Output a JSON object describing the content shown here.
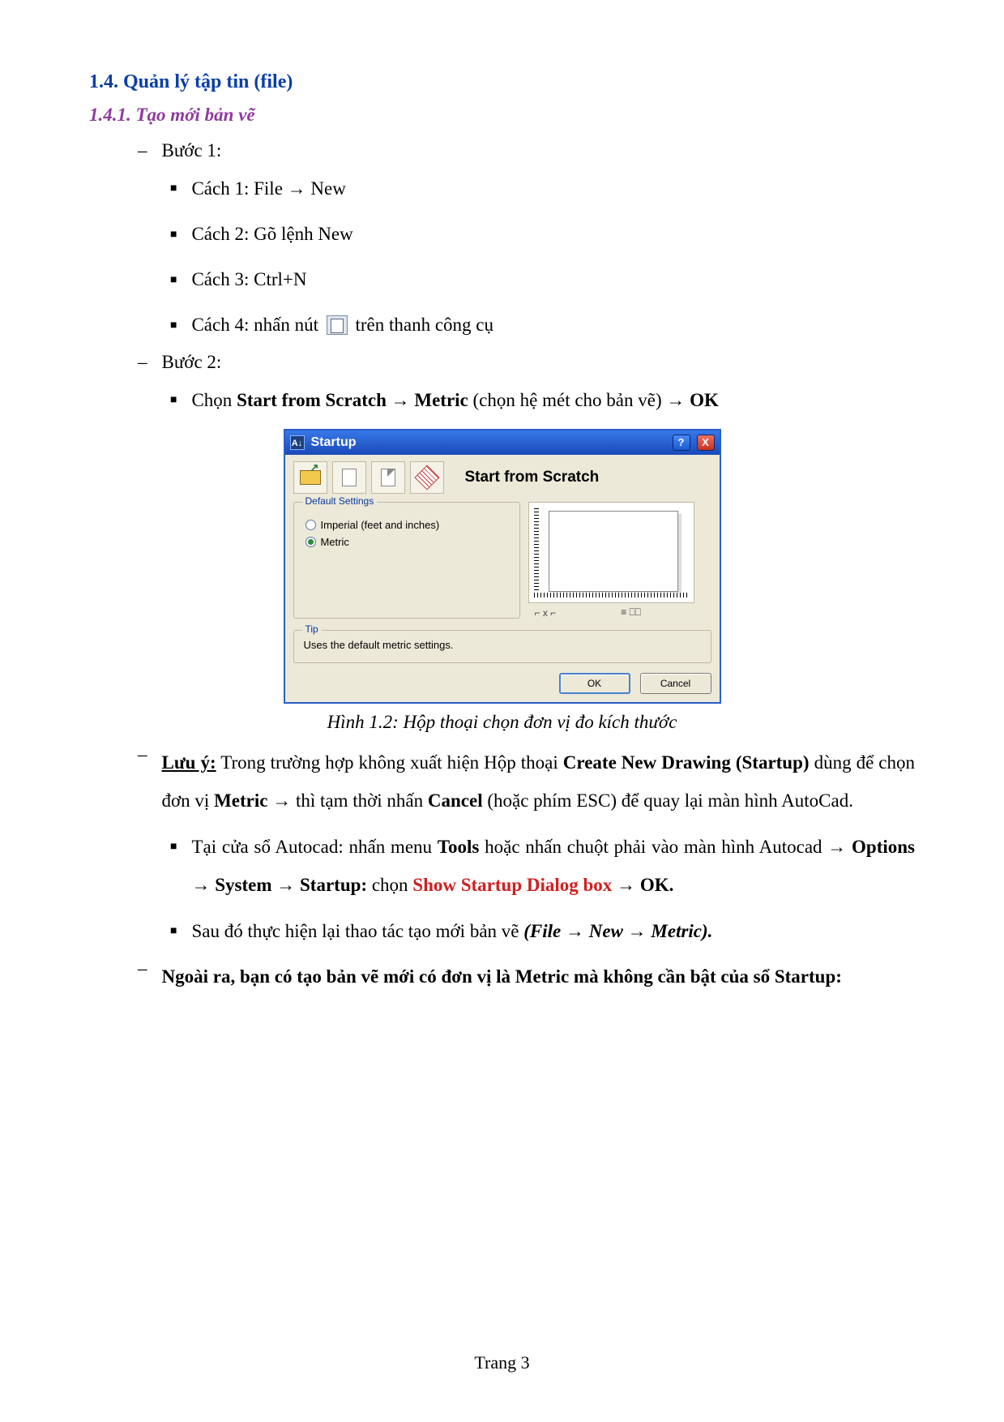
{
  "heading1": "1.4.  Quản lý tập tin (file)",
  "heading2": "1.4.1.  Tạo mới bản vẽ",
  "step1_label": "Bước 1:",
  "step1_ways": {
    "way1_a": "Cách 1: File ",
    "way1_b": " New",
    "way2": "Cách 2: Gõ lệnh New",
    "way3": "Cách 3: Ctrl+N",
    "way4_a": "Cách 4: nhấn nút ",
    "way4_b": " trên thanh công cụ"
  },
  "step2_label": "Bước 2:",
  "step2_line": {
    "a": "Chọn ",
    "b": "Start from Scratch ",
    "c": " Metric ",
    "d": "(chọn hệ mét cho bản vẽ) ",
    "e": " OK"
  },
  "dialog": {
    "title": "Startup",
    "heading": "Start from Scratch",
    "fieldset_legend": "Default Settings",
    "radio_imperial": "Imperial (feet and inches)",
    "radio_metric": "Metric",
    "tip_legend": "Tip",
    "tip_text": "Uses the default metric settings.",
    "ok": "OK",
    "cancel": "Cancel",
    "help": "?",
    "close": "X",
    "page_ctrl1": "⌐ x ⌐",
    "page_ctrl2": "≡  ⎕⎕"
  },
  "caption": "Hình 1.2: Hộp thoại chọn đơn vị đo kích thước",
  "note": {
    "prefix": "Lưu ý:",
    "line1_a": " Trong trường hợp không xuất hiện Hộp thoại ",
    "line1_b": "Create New Drawing (Startup)",
    "line1_c": " dùng để chọn đơn vị ",
    "line1_d": "Metric",
    "line1_e": " thì tạm thời nhấn ",
    "line1_f": "Cancel",
    "line1_g": " (hoặc phím ESC) để quay lại màn hình AutoCad.",
    "sub1_a": "Tại cửa sổ Autocad: nhấn menu ",
    "sub1_b": "Tools",
    "sub1_c": " hoặc nhấn chuột phải vào màn hình Autocad ",
    "sub1_d": " Options ",
    "sub1_e": " System ",
    "sub1_f": " Startup:",
    "sub1_g": " chọn ",
    "sub1_h": "Show Startup Dialog box ",
    "sub1_i": " OK.",
    "sub2_a": "Sau đó thực hiện lại thao tác tạo mới bản vẽ ",
    "sub2_b": "(File ",
    "sub2_c": " New ",
    "sub2_d": " Metric)."
  },
  "extra": "Ngoài ra, bạn có tạo bản vẽ mới có đơn vị là Metric mà không cần bật của sổ Startup:",
  "footer": "Trang 3",
  "arrow": "→"
}
